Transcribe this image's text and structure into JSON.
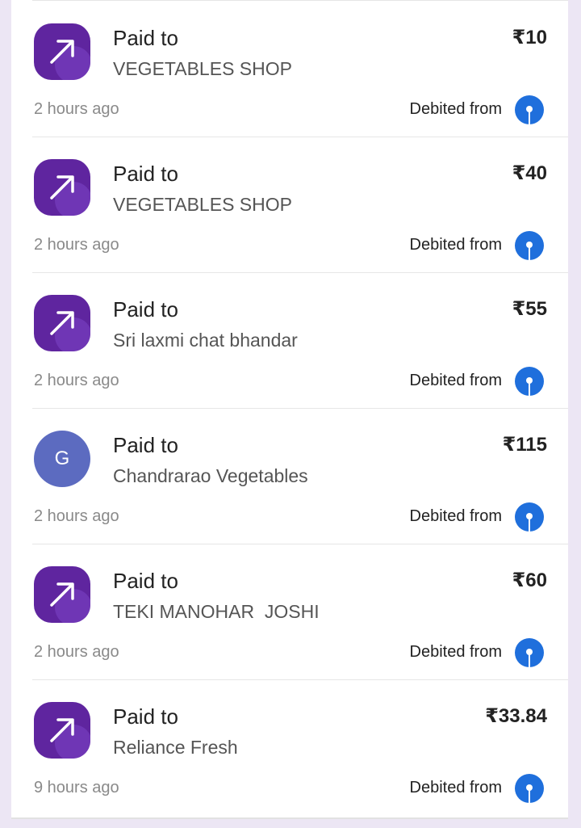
{
  "transactions": [
    {
      "avatar": "arrow-out",
      "title": "Paid to",
      "name": "VEGETABLES SHOP",
      "amount": "₹10",
      "time": "2 hours ago",
      "debited_label": "Debited from"
    },
    {
      "avatar": "arrow-out",
      "title": "Paid to",
      "name": "VEGETABLES SHOP",
      "amount": "₹40",
      "time": "2 hours ago",
      "debited_label": "Debited from"
    },
    {
      "avatar": "arrow-out",
      "title": "Paid to",
      "name": "Sri laxmi chat bhandar",
      "amount": "₹55",
      "time": "2 hours ago",
      "debited_label": "Debited from"
    },
    {
      "avatar": "letter",
      "avatar_letter": "G",
      "title": "Paid to",
      "name": "Chandrarao Vegetables",
      "amount": "₹115",
      "time": "2 hours ago",
      "debited_label": "Debited from"
    },
    {
      "avatar": "arrow-out",
      "title": "Paid to",
      "name": "TEKI MANOHAR  JOSHI",
      "amount": "₹60",
      "time": "2 hours ago",
      "debited_label": "Debited from"
    },
    {
      "avatar": "arrow-out",
      "title": "Paid to",
      "name": "Reliance Fresh",
      "amount": "₹33.84",
      "time": "9 hours ago",
      "debited_label": "Debited from"
    }
  ],
  "colors": {
    "avatar_purple": "#5f259f",
    "avatar_letter_bg": "#5c6bc0",
    "bank_icon_blue": "#1f6fdc",
    "page_bg": "#ece6f4"
  },
  "icons": {
    "arrow": "arrow-up-right-icon",
    "bank": "sbi-bank-icon"
  }
}
